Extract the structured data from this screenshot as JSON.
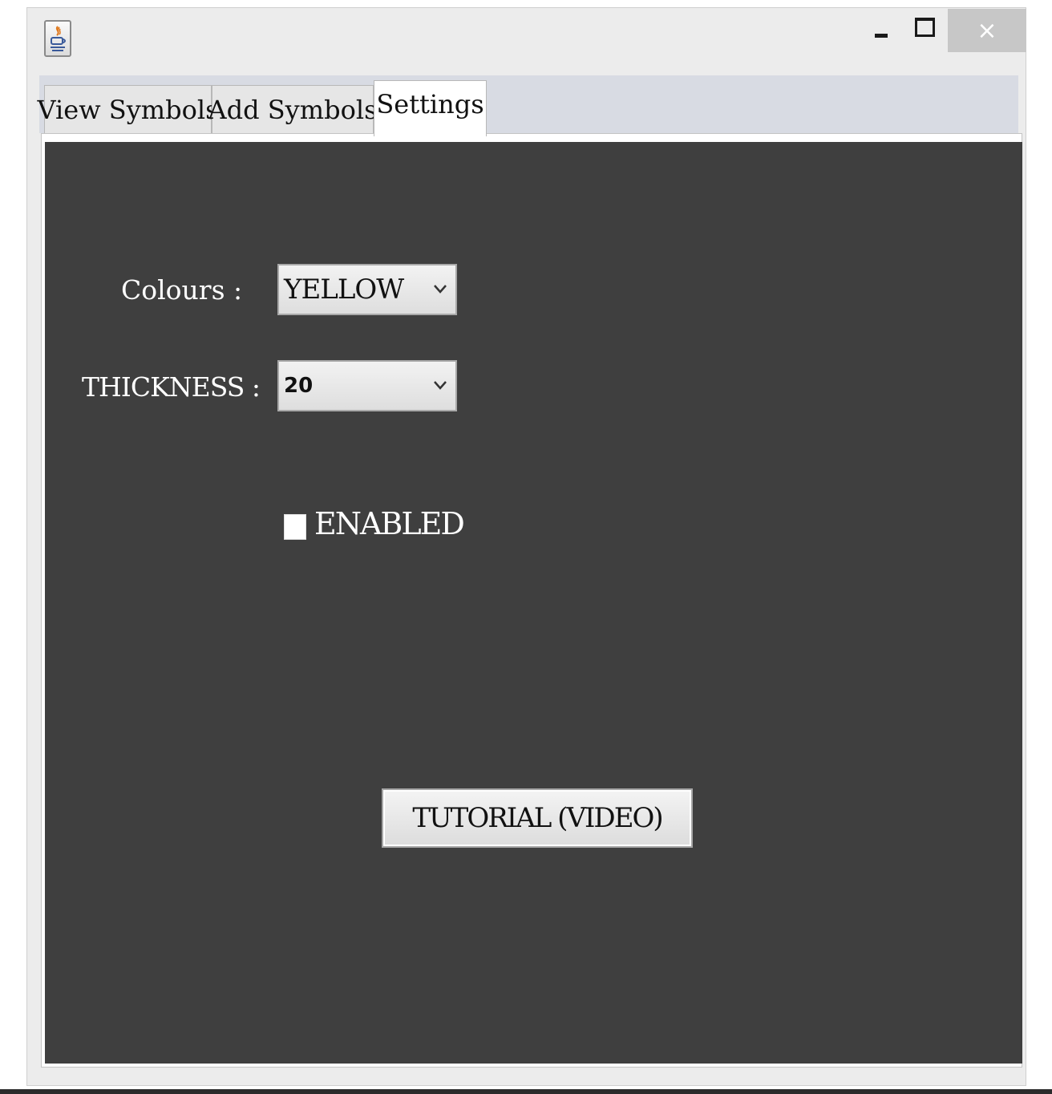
{
  "window": {
    "icons": {
      "app": "java-coffee-cup-icon",
      "minimize": "minimize-icon",
      "maximize": "maximize-icon",
      "close": "close-icon"
    },
    "close_glyph": "×"
  },
  "tabs": [
    {
      "label": "View Symbols",
      "active": false
    },
    {
      "label": "Add Symbols",
      "active": false
    },
    {
      "label": "Settings",
      "active": true
    }
  ],
  "settings": {
    "colours_label": "Colours :",
    "colours_value": "YELLOW",
    "thickness_label": "THICKNESS :",
    "thickness_value": "20",
    "enabled_label": "ENABLED",
    "enabled_checked": false,
    "tutorial_button": "TUTORIAL (VIDEO)"
  },
  "colors": {
    "panel_background": "#3f3f3f",
    "label_text": "#ffffff",
    "close_button": "#c7c7c7"
  }
}
